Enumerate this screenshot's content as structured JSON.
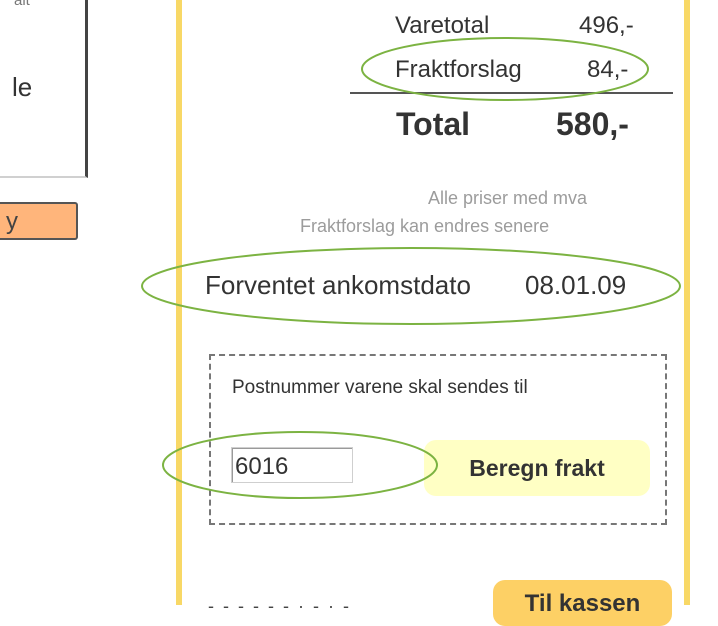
{
  "left_panel": {
    "fragment_top": "ait",
    "fragment_mid": "le",
    "button_fragment": "y"
  },
  "summary": {
    "varetotal_label": "Varetotal",
    "varetotal_value": "496,-",
    "frakt_label": "Fraktforslag",
    "frakt_value": "84,-",
    "total_label": "Total",
    "total_value": "580,-"
  },
  "notes": {
    "vat": "Alle priser med mva",
    "freight_change": "Fraktforslag kan endres senere"
  },
  "delivery": {
    "eta_label": "Forventet ankomstdato",
    "eta_value": "08.01.09"
  },
  "shipping": {
    "label": "Postnummer varene skal sendes til",
    "postal_code": "6016",
    "calc_button": "Beregn frakt"
  },
  "checkout": {
    "button": "Til kassen",
    "fragment": "- - -  -  - - ·  - · -"
  },
  "colors": {
    "rail": "#f8d866",
    "annotation": "#7cb342",
    "calc_button_bg": "#ffffc4",
    "checkout_bg": "#fdd065",
    "left_button_bg": "#ffb57b"
  }
}
